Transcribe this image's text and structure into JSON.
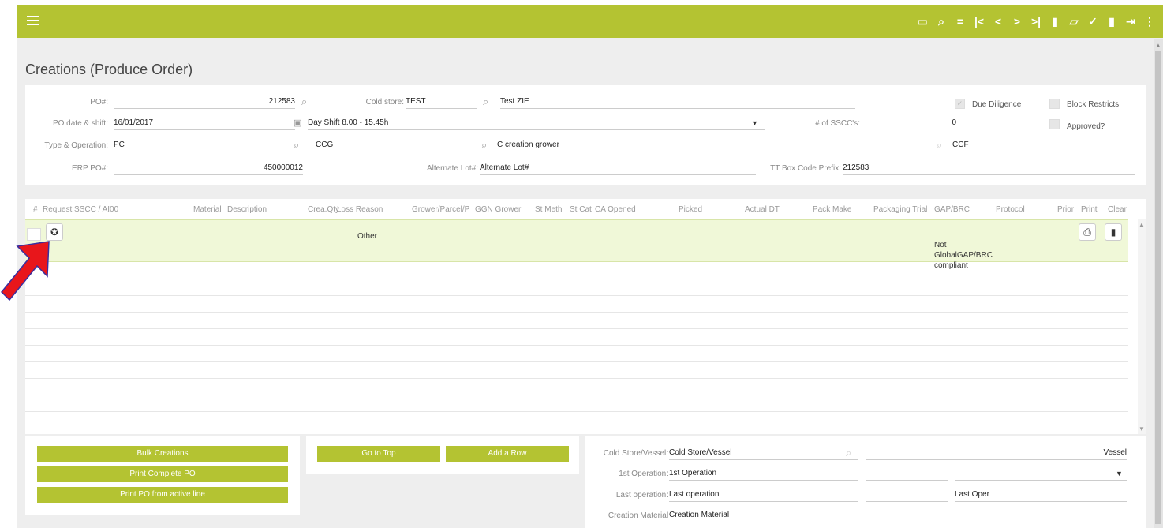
{
  "header": {
    "toolbar_icons": [
      "calendar-icon",
      "search-icon",
      "equals-icon",
      "first-page-icon",
      "previous-icon",
      "next-icon",
      "last-page-icon",
      "new-document-icon",
      "edit-icon",
      "check-icon",
      "delete-icon",
      "exit-icon",
      "more-vert-icon"
    ],
    "toolbar_glyphs": [
      "▭",
      "⌕",
      "=",
      "|<",
      "<",
      ">",
      ">|",
      "▮",
      "▱",
      "✓",
      "▮",
      "⇥",
      "⋮"
    ]
  },
  "page": {
    "title": "Creations (Produce Order)"
  },
  "form": {
    "po_label": "PO#:",
    "po_value": "212583",
    "cold_store_label": "Cold store:",
    "cold_store_value": "TEST",
    "cold_store_desc": "Test ZIE",
    "due_diligence_label": "Due Diligence",
    "block_restricts_label": "Block Restricts",
    "po_date_label": "PO date & shift:",
    "po_date_value": "16/01/2017",
    "shift_value": "Day Shift 8.00 - 15.45h",
    "sscc_label": "# of SSCC's:",
    "sscc_value": "0",
    "approved_label": "Approved?",
    "type_label": "Type & Operation:",
    "type_value": "PC",
    "operation_value": "CCG",
    "operation_desc": "C creation grower",
    "ccf_value": "CCF",
    "erp_label": "ERP PO#:",
    "erp_value": "450000012",
    "alt_lot_label": "Alternate Lot#:",
    "alt_lot_value": "Alternate Lot#",
    "tt_label": "TT Box Code Prefix:",
    "tt_value": "212583"
  },
  "grid": {
    "columns": [
      "#",
      "Request SSCC / AI00",
      "Material",
      "Description",
      "Crea.Qty",
      "Loss Reason",
      "Grower/Parcel/P",
      "GGN Grower",
      "St Meth",
      "St Cat",
      "CA Opened",
      "Picked",
      "Actual DT",
      "Pack Make",
      "Packaging Trial",
      "GAP/BRC",
      "Protocol",
      "Prior",
      "Print",
      "Clear"
    ],
    "rows": [
      {
        "loss_reason": "Other",
        "gap_brc": "Not GlobalGAP/BRC compliant"
      }
    ]
  },
  "actions": {
    "bulk_creations": "Bulk Creations",
    "print_complete_po": "Print Complete PO",
    "print_active_line": "Print PO from active line",
    "go_to_top": "Go to Top",
    "add_row": "Add a Row"
  },
  "bottom_form": {
    "cold_store_vessel_label": "Cold Store/Vessel:",
    "cold_store_vessel_value": "Cold Store/Vessel",
    "vessel_value": "Vessel",
    "first_op_label": "1st Operation:",
    "first_op_value": "1st Operation",
    "last_op_label": "Last operation:",
    "last_op_value": "Last operation",
    "last_oper_value": "Last Oper",
    "creation_material_label": "Creation Material",
    "creation_material_value": "Creation Material"
  },
  "colors": {
    "accent": "#b4c332",
    "active_row": "#f0f8d8",
    "arrow": "#e8161b"
  }
}
